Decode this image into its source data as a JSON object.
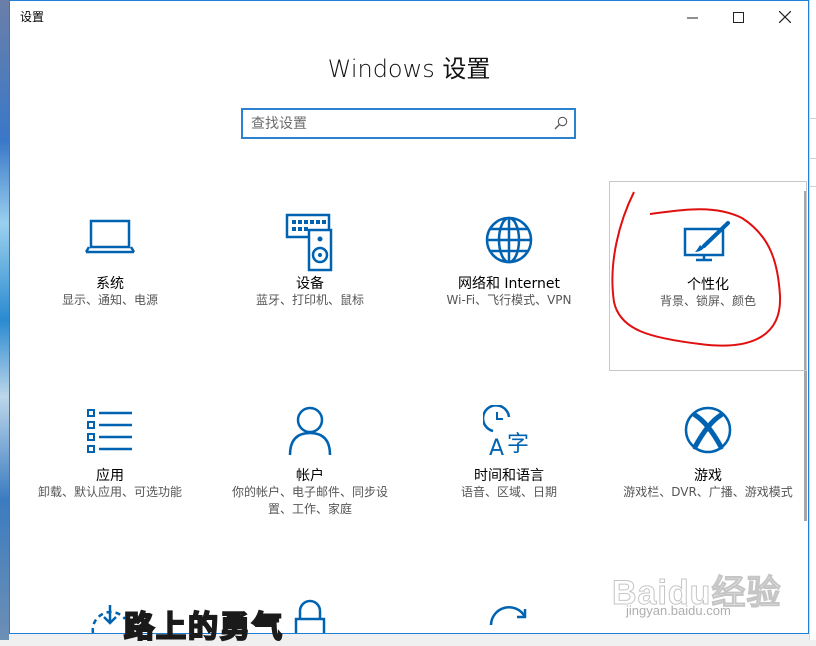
{
  "window": {
    "title": "设置",
    "page_title": "Windows 设置"
  },
  "search": {
    "placeholder": "查找设置"
  },
  "categories": [
    {
      "name": "系统",
      "desc": "显示、通知、电源",
      "icon": "laptop-icon"
    },
    {
      "name": "设备",
      "desc": "蓝牙、打印机、鼠标",
      "icon": "keyboard-speaker-icon"
    },
    {
      "name": "网络和 Internet",
      "desc": "Wi-Fi、飞行模式、VPN",
      "icon": "globe-icon"
    },
    {
      "name": "个性化",
      "desc": "背景、锁屏、颜色",
      "icon": "monitor-brush-icon"
    },
    {
      "name": "应用",
      "desc": "卸载、默认应用、可选功能",
      "icon": "list-icon"
    },
    {
      "name": "帐户",
      "desc": "你的帐户、电子邮件、同步设置、工作、家庭",
      "icon": "person-icon"
    },
    {
      "name": "时间和语言",
      "desc": "语音、区域、日期",
      "icon": "clock-language-icon"
    },
    {
      "name": "游戏",
      "desc": "游戏栏、DVR、广播、游戏模式",
      "icon": "xbox-icon"
    }
  ],
  "overlay": {
    "caption": "路上的勇气",
    "watermark_brand": "Baidu经验",
    "watermark_url": "jingyan.baidu.com"
  },
  "colors": {
    "accent": "#0063b1",
    "annotation": "#e01010"
  }
}
